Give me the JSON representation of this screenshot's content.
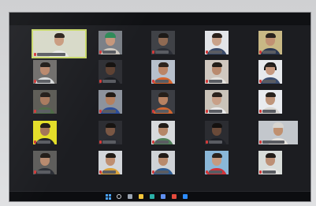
{
  "meeting": {
    "view": "gallery",
    "grid": {
      "columns": 5,
      "rows": 5
    },
    "active_speaker_index": 0
  },
  "participants": [
    {
      "skin": "#c99b7e",
      "hair": "#2b221d",
      "shirt": "#e8e8e6",
      "bg": "#d7d9c8",
      "headwear": "none",
      "mic_muted": true
    },
    {
      "skin": "#c5977c",
      "hair": "#2f2a25",
      "shirt": "#cfc9c0",
      "bg": "#7a7f86",
      "headwear": "cap",
      "cap_color": "#2e8a58",
      "mic_muted": true
    },
    {
      "skin": "#8f6a53",
      "hair": "#1d1a18",
      "shirt": "#2b2e36",
      "bg": "#404247",
      "headwear": "none",
      "mic_muted": true
    },
    {
      "skin": "#c9a28a",
      "hair": "#2a211c",
      "shirt": "#394a6a",
      "bg": "#e2e4e8",
      "headwear": "none",
      "mic_muted": true
    },
    {
      "skin": "#c19173",
      "hair": "#2a231e",
      "shirt": "#2a3752",
      "bg": "#c8b885",
      "headwear": "none",
      "mic_muted": true
    },
    {
      "skin": "#b9876b",
      "hair": "#201b17",
      "shirt": "#d8dadb",
      "bg": "#6f6d6b",
      "headwear": "none",
      "mic_muted": true
    },
    {
      "skin": "#5e4233",
      "hair": "#151210",
      "shirt": "#1d1f24",
      "bg": "#2f3035",
      "headwear": "none",
      "mic_muted": true
    },
    {
      "skin": "#bb8566",
      "hair": "#2d241e",
      "shirt": "#d9642b",
      "bg": "#b7c0cc",
      "headwear": "none",
      "mic_muted": true
    },
    {
      "skin": "#b98a6e",
      "hair": "#231d18",
      "shirt": "#e4e2de",
      "bg": "#cfc7bf",
      "headwear": "none",
      "mic_muted": true
    },
    {
      "skin": "#c79a80",
      "hair": "#2d2520",
      "shirt": "#3b4d70",
      "bg": "#e7e9ec",
      "headwear": "headset",
      "mic_muted": true
    },
    {
      "skin": "#a8795d",
      "hair": "#221c18",
      "shirt": "#4c6a45",
      "bg": "#5b5a54",
      "headwear": "none",
      "mic_muted": true
    },
    {
      "skin": "#b48060",
      "hair": "#211b16",
      "shirt": "#2c4d9a",
      "bg": "#8d939d",
      "headwear": "none",
      "mic_muted": true
    },
    {
      "skin": "#b78262",
      "hair": "#261f1a",
      "shirt": "#d26630",
      "bg": "#3c3e44",
      "headwear": "none",
      "mic_muted": true
    },
    {
      "skin": "#c8a088",
      "hair": "#2a221d",
      "shirt": "#e9e9e9",
      "bg": "#c9c3b9",
      "headwear": "none",
      "mic_muted": true
    },
    {
      "skin": "#bf957b",
      "hair": "#29221d",
      "shirt": "#d8d6d2",
      "bg": "#e9ebef",
      "headwear": "none",
      "mic_muted": true
    },
    {
      "skin": "#a27356",
      "hair": "#1e1915",
      "shirt": "#1e2026",
      "bg": "#e3de27",
      "headwear": "none",
      "mic_muted": true
    },
    {
      "skin": "#7a5744",
      "hair": "#171412",
      "shirt": "#2a2c33",
      "bg": "#2d2e33",
      "headwear": "none",
      "mic_muted": true
    },
    {
      "skin": "#b58668",
      "hair": "#221c18",
      "shirt": "#50805a",
      "bg": "#d7d9dc",
      "headwear": "none",
      "mic_muted": true
    },
    {
      "skin": "#6a4a39",
      "hair": "#141110",
      "shirt": "#1f2127",
      "bg": "#2b2c31",
      "headwear": "none",
      "mic_muted": true
    },
    {
      "skin": "#c0906f",
      "hair": "#2a221c",
      "shirt": "#e6e3de",
      "bg": "#c3c7cc",
      "headwear": "cap",
      "cap_color": "#d7d4cf",
      "mic_muted": true
    },
    {
      "skin": "#b88a6e",
      "hair": "#231d18",
      "shirt": "#2c2f36",
      "bg": "#5e5d5b",
      "headwear": "none",
      "mic_muted": true
    },
    {
      "skin": "#bf8e70",
      "hair": "#221c17",
      "shirt": "#d9a23a",
      "bg": "#d3d6da",
      "headwear": "none",
      "mic_muted": true
    },
    {
      "skin": "#b98a6c",
      "hair": "#211b17",
      "shirt": "#2f5e95",
      "bg": "#cfd2d6",
      "headwear": "none",
      "mic_muted": true
    },
    {
      "skin": "#c59a80",
      "hair": "#2a231e",
      "shirt": "#d2333a",
      "bg": "#8ab7d8",
      "headwear": "none",
      "mic_muted": true
    },
    {
      "skin": "#bd9075",
      "hair": "#221c18",
      "shirt": "#e3e3e1",
      "bg": "#d8dcd9",
      "headwear": "none",
      "mic_muted": true
    }
  ],
  "taskbar": {
    "icons": [
      {
        "name": "start-icon",
        "color": "#4aa3ff"
      },
      {
        "name": "search-icon",
        "color": "#cfd2d8"
      },
      {
        "name": "task-view-icon",
        "color": "#9aa4b2"
      },
      {
        "name": "file-explorer-icon",
        "color": "#f3c53a"
      },
      {
        "name": "edge-icon",
        "color": "#2bb0a8"
      },
      {
        "name": "store-icon",
        "color": "#5f8ff0"
      },
      {
        "name": "chrome-icon",
        "color": "#e44a3c"
      },
      {
        "name": "zoom-icon",
        "color": "#2d8cff"
      }
    ]
  }
}
